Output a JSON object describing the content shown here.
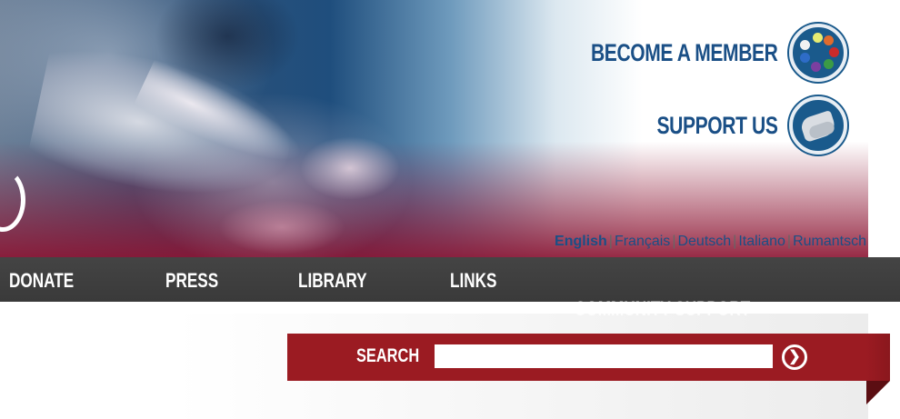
{
  "header": {
    "become_member": "BECOME A MEMBER",
    "support_us": "SUPPORT US",
    "member_icon": "people-circle-icon",
    "support_icon": "handshake-icon"
  },
  "languages": [
    {
      "label": "English",
      "active": true
    },
    {
      "label": "Français",
      "active": false
    },
    {
      "label": "Deutsch",
      "active": false
    },
    {
      "label": "Italiano",
      "active": false
    },
    {
      "label": "Rumantsch",
      "active": false
    }
  ],
  "nav": {
    "items": [
      {
        "label": "DONATE"
      },
      {
        "label": "PRESS"
      },
      {
        "label": "LIBRARY"
      },
      {
        "label": "LINKS"
      }
    ],
    "ghost_label": "COMMUNITY SUPPORT"
  },
  "search": {
    "label": "SEARCH",
    "value": "",
    "go_icon": "arrow-circle-right-icon"
  },
  "colors": {
    "brand_blue": "#1a4f86",
    "search_red": "#9b1b22",
    "nav_dark": "#3e3e3e"
  }
}
